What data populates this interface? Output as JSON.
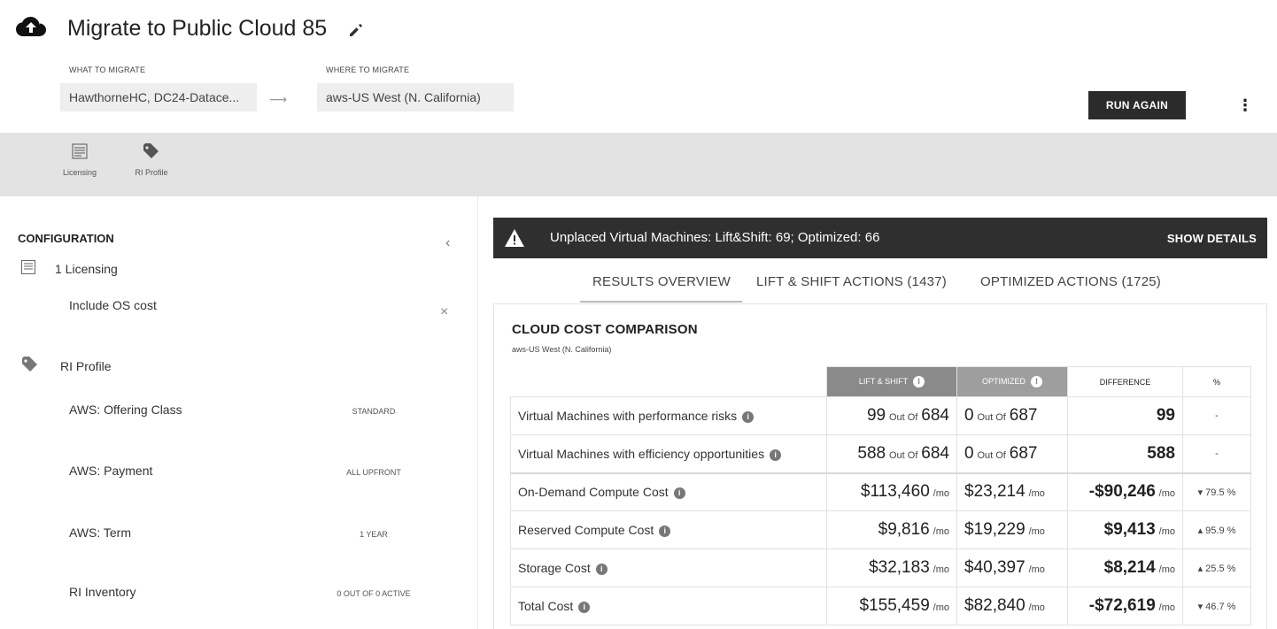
{
  "header": {
    "title": "Migrate to Public Cloud 85",
    "what_label": "WHAT TO MIGRATE",
    "what_value": "HawthorneHC, DC24-Datace...",
    "where_label": "WHERE TO MIGRATE",
    "where_value": "aws-US West (N. California)",
    "run_label": "RUN AGAIN",
    "kebab": "⋮"
  },
  "toolbar": {
    "licensing_label": "Licensing",
    "ri_profile_label": "RI Profile"
  },
  "config": {
    "title": "CONFIGURATION",
    "licensing_heading": "1 Licensing",
    "include_os": "Include OS cost",
    "ri_profile_heading": "RI Profile",
    "items": [
      {
        "label": "AWS: Offering Class",
        "value": "STANDARD"
      },
      {
        "label": "AWS: Payment",
        "value": "ALL UPFRONT"
      },
      {
        "label": "AWS: Term",
        "value": "1 YEAR"
      },
      {
        "label": "RI Inventory",
        "value": "0 OUT OF 0 ACTIVE"
      }
    ]
  },
  "alert": {
    "text": "Unplaced Virtual Machines: Lift&Shift: 69; Optimized: 66",
    "link": "SHOW DETAILS"
  },
  "tabs": [
    {
      "label": "RESULTS OVERVIEW"
    },
    {
      "label": "LIFT & SHIFT ACTIONS (1437)"
    },
    {
      "label": "OPTIMIZED ACTIONS (1725)"
    }
  ],
  "comparison": {
    "title": "CLOUD COST COMPARISON",
    "subtitle": "aws-US West (N. California)",
    "headers": {
      "lift": "LIFT & SHIFT",
      "opt": "OPTIMIZED",
      "diff": "DIFFERENCE",
      "pct": "%"
    },
    "out_of": "Out Of",
    "mo": "/mo",
    "rows": [
      {
        "label": "Virtual Machines with performance risks",
        "lift": "99",
        "lift_total": "684",
        "opt": "0",
        "opt_total": "687",
        "diff": "99",
        "pct": "-"
      },
      {
        "label": "Virtual Machines with efficiency opportunities",
        "lift": "588",
        "lift_total": "684",
        "opt": "0",
        "opt_total": "687",
        "diff": "588",
        "pct": "-"
      },
      {
        "label": "On-Demand Compute Cost",
        "lift": "$113,460",
        "opt": "$23,214",
        "diff": "-$90,246",
        "pct": "▾ 79.5 %"
      },
      {
        "label": "Reserved Compute Cost",
        "lift": "$9,816",
        "opt": "$19,229",
        "diff": "$9,413",
        "pct": "▴ 95.9 %"
      },
      {
        "label": "Storage Cost",
        "lift": "$32,183",
        "opt": "$40,397",
        "diff": "$8,214",
        "pct": "▴ 25.5 %"
      },
      {
        "label": "Total Cost",
        "lift": "$155,459",
        "opt": "$82,840",
        "diff": "-$72,619",
        "pct": "▾ 46.7 %"
      }
    ]
  }
}
